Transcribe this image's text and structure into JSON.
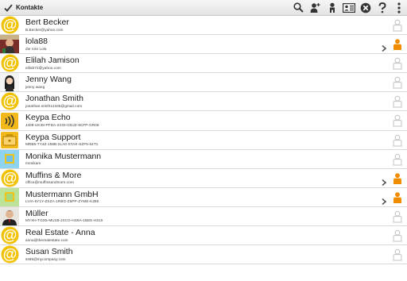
{
  "app": {
    "title": "Kontakte"
  },
  "toolbar": {
    "icons": [
      "search-icon",
      "add-person-icon",
      "person-icon",
      "contact-card-icon",
      "close-icon",
      "help-icon",
      "overflow-menu-icon"
    ],
    "accent": "#f5a623"
  },
  "contacts": [
    {
      "name": "Bert Becker",
      "detail": "B.Becker@yahoo.com",
      "avatar": "email-at",
      "status": "grey",
      "chevron": false
    },
    {
      "name": "lola88",
      "detail": "die rote Lola",
      "avatar": "photo-lola",
      "status": "orange",
      "chevron": true
    },
    {
      "name": "Elilah Jamison",
      "detail": "elilah72@yahoo.com",
      "avatar": "email-at",
      "status": "grey",
      "chevron": false
    },
    {
      "name": "Jenny Wang",
      "detail": "jenny wang",
      "avatar": "photo-jenny",
      "status": "grey",
      "chevron": false
    },
    {
      "name": "Jonathan Smith",
      "detail": "jonathan.smith12345@gmail.com",
      "avatar": "email-at",
      "status": "grey",
      "chevron": false
    },
    {
      "name": "Keypa Echo",
      "detail": "J408-UK38-PFDA-2XOI-GDJZ-9CFP-GR09",
      "avatar": "keypa-echo",
      "status": "grey",
      "chevron": false
    },
    {
      "name": "Keypa Support",
      "detail": "MRB6-TY4Z-158B-2LA0-STAK-SZF5-64T1",
      "avatar": "keypa-support",
      "status": "grey",
      "chevron": false
    },
    {
      "name": "Monika Mustermann",
      "detail": "monikam",
      "avatar": "square-blue",
      "status": "grey",
      "chevron": false
    },
    {
      "name": "Muffins & More",
      "detail": "office@muffinsandmore.com",
      "avatar": "email-at",
      "status": "orange",
      "chevron": true
    },
    {
      "name": "Mustermann GmbH",
      "detail": "LVIA-6Y1Y-ZSZA-1RBG-Z5PP-ZYME-K395",
      "avatar": "square-green",
      "status": "orange",
      "chevron": true
    },
    {
      "name": "Müller",
      "detail": "MYXH-TGX5-MU1B-JXCG-HS6A-1B8S-H31S",
      "avatar": "photo-mueller",
      "status": "grey",
      "chevron": false
    },
    {
      "name": "Real Estate - Anna",
      "detail": "anna@therealestate.com",
      "avatar": "email-at",
      "status": "grey",
      "chevron": false
    },
    {
      "name": "Susan Smith",
      "detail": "ss85@mycompany.com",
      "avatar": "email-at",
      "status": "grey",
      "chevron": false
    }
  ]
}
